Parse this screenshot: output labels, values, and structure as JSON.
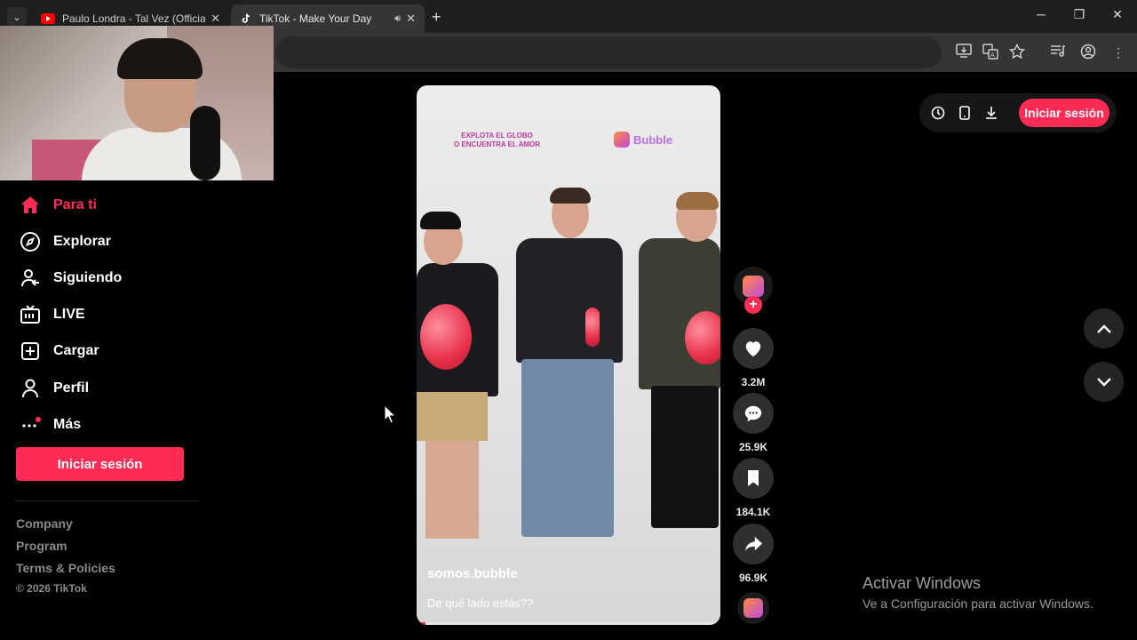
{
  "browser": {
    "tabs": [
      {
        "title": "Paulo Londra - Tal Vez (Official",
        "favicon": "youtube-icon",
        "active": false
      },
      {
        "title": "TikTok - Make Your Day",
        "favicon": "tiktok-icon",
        "active": true
      }
    ],
    "new_tab": "+",
    "window_controls": {
      "minimize": "─",
      "restore": "❐",
      "close": "✕"
    }
  },
  "sidebar": {
    "items": [
      {
        "label": "Para ti",
        "icon": "home-icon",
        "active": true
      },
      {
        "label": "Explorar",
        "icon": "compass-icon",
        "active": false
      },
      {
        "label": "Siguiendo",
        "icon": "following-icon",
        "active": false
      },
      {
        "label": "LIVE",
        "icon": "live-icon",
        "active": false
      },
      {
        "label": "Cargar",
        "icon": "upload-icon",
        "active": false
      },
      {
        "label": "Perfil",
        "icon": "profile-icon",
        "active": false
      },
      {
        "label": "Más",
        "icon": "more-icon",
        "active": false
      }
    ],
    "login_label": "Iniciar sesión",
    "footer_links": [
      "Company",
      "Program",
      "Terms & Policies"
    ],
    "copyright": "© 2026 TikTok"
  },
  "video": {
    "promo_line1": "EXPLOTA EL GLOBO",
    "promo_line2": "O ENCUENTRA EL AMOR",
    "brand": "Bubble",
    "username": "somos.bubble",
    "description": "De qué lado estás??",
    "progress": 0.03
  },
  "actions": {
    "likes": "3.2M",
    "comments": "25.9K",
    "saves": "184.1K",
    "shares": "96.9K"
  },
  "topbar": {
    "login_label": "Iniciar sesión"
  },
  "watermark": {
    "title": "Activar Windows",
    "subtitle": "Ve a Configuración para activar Windows."
  },
  "colors": {
    "accent": "#fe2c55",
    "background": "#000000"
  }
}
